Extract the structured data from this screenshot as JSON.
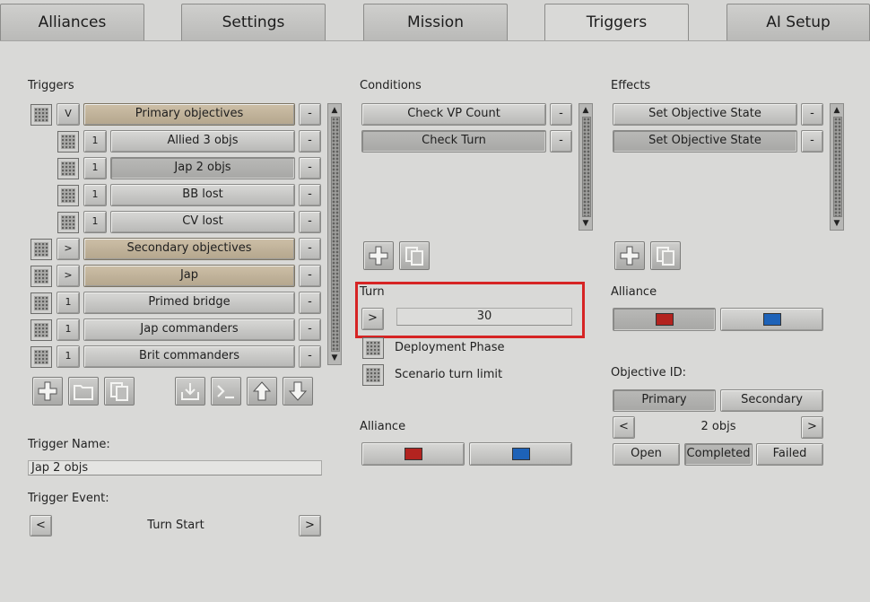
{
  "tabs": [
    "Alliances",
    "Settings",
    "Mission",
    "Triggers",
    "AI Setup"
  ],
  "active_tab": "Triggers",
  "triggers": {
    "header": "Triggers",
    "items": [
      {
        "indent": 0,
        "level": "V",
        "label": "Primary objectives",
        "style": "tan",
        "remove": "-"
      },
      {
        "indent": 1,
        "level": "1",
        "label": "Allied 3 objs",
        "style": "normal",
        "remove": "-"
      },
      {
        "indent": 1,
        "level": "1",
        "label": "Jap  2 objs",
        "style": "selected",
        "remove": "-"
      },
      {
        "indent": 1,
        "level": "1",
        "label": "BB lost",
        "style": "normal",
        "remove": "-"
      },
      {
        "indent": 1,
        "level": "1",
        "label": "CV lost",
        "style": "normal",
        "remove": "-"
      },
      {
        "indent": 0,
        "level": ">",
        "label": "Secondary objectives",
        "style": "tan",
        "remove": "-"
      },
      {
        "indent": 0,
        "level": ">",
        "label": "Jap",
        "style": "tan",
        "remove": "-"
      },
      {
        "indent": 0,
        "level": "1",
        "label": "Primed bridge",
        "style": "normal",
        "remove": "-"
      },
      {
        "indent": 0,
        "level": "1",
        "label": "Jap commanders",
        "style": "normal",
        "remove": "-"
      },
      {
        "indent": 0,
        "level": "1",
        "label": "Brit commanders",
        "style": "normal",
        "remove": "-"
      }
    ],
    "toolbar_icons": [
      "add-icon",
      "folder-icon",
      "copy-icon",
      "import-icon",
      "console-icon",
      "move-up-icon",
      "move-down-icon"
    ],
    "trigger_name_label": "Trigger Name:",
    "trigger_name_value": "Jap  2 objs",
    "trigger_event_label": "Trigger Event:",
    "trigger_event_value": "Turn Start",
    "prev": "<",
    "next": ">"
  },
  "conditions": {
    "header": "Conditions",
    "items": [
      {
        "label": "Check VP Count",
        "selected": false,
        "remove": "-"
      },
      {
        "label": "Check Turn",
        "selected": true,
        "remove": "-"
      }
    ],
    "turn_label": "Turn",
    "turn_button": ">",
    "turn_value": "30",
    "deployment_phase_label": "Deployment Phase",
    "scenario_limit_label": "Scenario turn limit",
    "alliance_label": "Alliance",
    "alliance_colors": [
      "#b3231f",
      "#1d62b8"
    ]
  },
  "effects": {
    "header": "Effects",
    "items": [
      {
        "label": "Set Objective State",
        "selected": false,
        "remove": "-"
      },
      {
        "label": "Set Objective State",
        "selected": true,
        "remove": "-"
      }
    ],
    "alliance_label": "Alliance",
    "alliance_colors": [
      "#b3231f",
      "#1d62b8"
    ],
    "objective_id_label": "Objective ID:",
    "objective_types": [
      "Primary",
      "Secondary"
    ],
    "objective_value": "2 objs",
    "prev": "<",
    "next": ">",
    "states": [
      "Open",
      "Completed",
      "Failed"
    ],
    "selected_state": "Completed"
  },
  "scroll_arrows": {
    "up": "▲",
    "down": "▼"
  },
  "colors": {
    "highlight": "#d62424",
    "tan": "#c4b59b"
  }
}
